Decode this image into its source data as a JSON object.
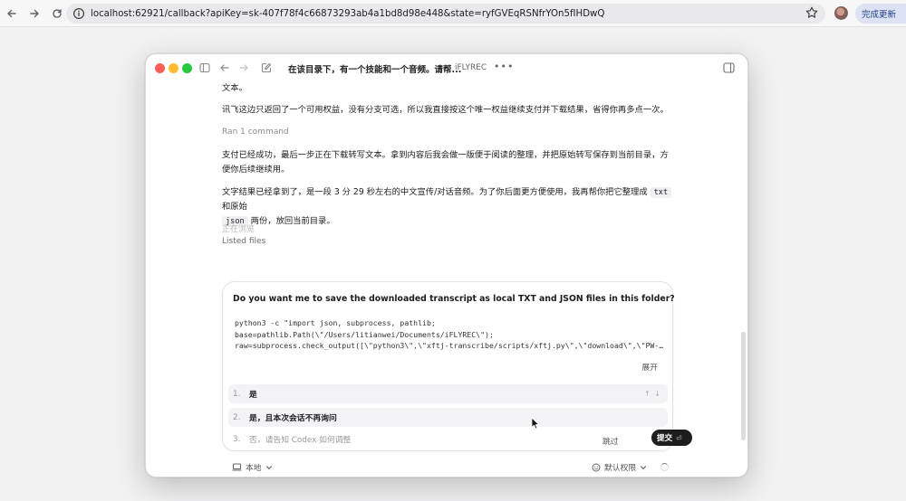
{
  "browser": {
    "url": "localhost:62921/callback?apiKey=sk-407f78f4c66873293ab4a1bd8d98e448&state=ryfGVEqRSNfrYOn5fIHDwQ",
    "update_label": "完成更新"
  },
  "window": {
    "title": "在该目录下，有一个技能和一个音频。请帮...",
    "project": "iFLYREC"
  },
  "chat": {
    "line0": "文本。",
    "msg1": "讯飞这边只返回了一个可用权益，没有分支可选，所以我直接按这个唯一权益继续支付并下载结果，省得你再多点一次。",
    "ran_command": "Ran 1 command",
    "msg2": "支付已经成功，最后一步正在下载转写文本。拿到内容后我会做一版便于阅读的整理，并把原始转写保存到当前目录，方便你后续继续用。",
    "msg3_pre": "文字结果已经拿到了，是一段 3 分 29 秒左右的中文宣传/对话音频。为了你后面更方便使用，我再帮你把它整理成",
    "msg3_code1": "txt",
    "msg3_mid": "和原始",
    "msg3_code2": "json",
    "msg3_post": "两份，放回当前目录。",
    "browsing": "正在浏览",
    "listed_files": "Listed files"
  },
  "approval": {
    "question": "Do you want me to save the downloaded transcript as local TXT and JSON files in this folder?",
    "code_lines": [
      "python3 -c \"import json, subprocess, pathlib;",
      "base=pathlib.Path(\\\"/Users/litianwei/Documents/iFLYREC\\\");",
      "raw=subprocess.check_output([\\\"python3\\\",\\\"xftj-transcribe/scripts/xftj.py\\\",\\\"download\\\",\\\"PW-…"
    ],
    "expand_label": "展开",
    "options": [
      {
        "num": "1.",
        "label": "是",
        "arrows": "↑ ↓"
      },
      {
        "num": "2.",
        "label": "是，且本次会话不再询问"
      },
      {
        "num": "3.",
        "label": "否，请告知 Codex 如何调整"
      }
    ],
    "skip_label": "跳过",
    "submit_label": "提交",
    "submit_key": "⏎"
  },
  "footer": {
    "local_label": "本地",
    "permission_label": "默认权限"
  }
}
